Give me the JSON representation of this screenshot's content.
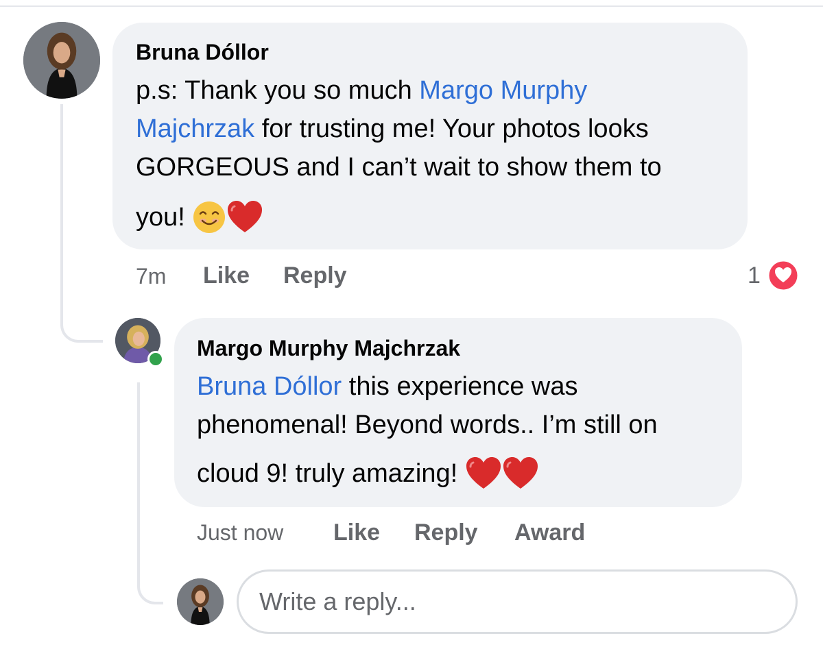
{
  "comment": {
    "author": "Bruna Dóllor",
    "line1_text": "p.s: Thank you so much ",
    "line1_mention": "Margo Murphy",
    "line2_mention": "Majchrzak",
    "line2_text": " for trusting me! Your photos looks",
    "line3_text": "GORGEOUS and I can’t wait to show them to",
    "line4_text": "you! ",
    "emojis": [
      "smiling-face-icon",
      "red-heart-icon"
    ],
    "time": "7m",
    "like_label": "Like",
    "reply_label": "Reply",
    "reaction_count": "1",
    "reaction_type": "love"
  },
  "reply": {
    "author": "Margo Murphy Majchrzak",
    "line1_mention": "Bruna Dóllor",
    "line1_text": " this experience was",
    "line2_text": "phenomenal! Beyond words.. I’m still on",
    "line3_text": "cloud 9! truly amazing! ",
    "emojis": [
      "red-heart-icon",
      "red-heart-icon"
    ],
    "time": "Just now",
    "like_label": "Like",
    "reply_label": "Reply",
    "award_label": "Award",
    "online": true
  },
  "composer": {
    "placeholder": "Write a reply..."
  },
  "colors": {
    "bubble": "#f0f2f5",
    "mention": "#2f6fd6",
    "meta_text": "#65676b",
    "love_reaction": "#f33e58",
    "online": "#31a24c"
  }
}
